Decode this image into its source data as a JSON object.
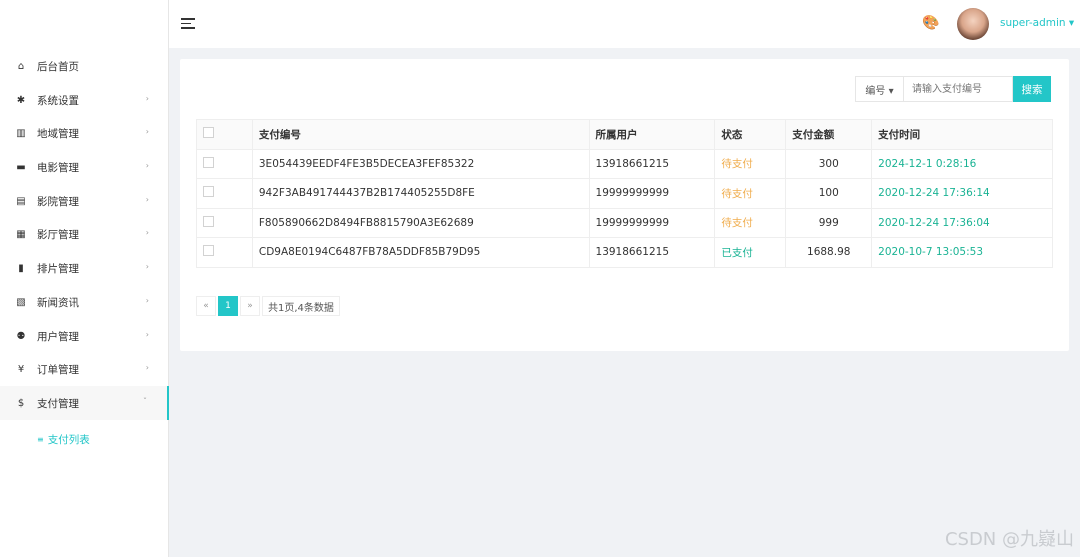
{
  "sidebar": {
    "items": [
      {
        "label": "后台首页",
        "icon": "home-icon",
        "glyph": "⌂",
        "has_arrow": false
      },
      {
        "label": "系统设置",
        "icon": "gear-icon",
        "glyph": "✱",
        "has_arrow": true
      },
      {
        "label": "地域管理",
        "icon": "map-icon",
        "glyph": "▥",
        "has_arrow": true
      },
      {
        "label": "电影管理",
        "icon": "film-icon",
        "glyph": "▬",
        "has_arrow": true
      },
      {
        "label": "影院管理",
        "icon": "cinema-icon",
        "glyph": "▤",
        "has_arrow": true
      },
      {
        "label": "影厅管理",
        "icon": "hall-icon",
        "glyph": "▦",
        "has_arrow": true
      },
      {
        "label": "排片管理",
        "icon": "schedule-icon",
        "glyph": "▮",
        "has_arrow": true
      },
      {
        "label": "新闻资讯",
        "icon": "news-icon",
        "glyph": "▧",
        "has_arrow": true
      },
      {
        "label": "用户管理",
        "icon": "users-icon",
        "glyph": "⚉",
        "has_arrow": true
      },
      {
        "label": "订单管理",
        "icon": "yen-icon",
        "glyph": "¥",
        "has_arrow": true
      },
      {
        "label": "支付管理",
        "icon": "dollar-icon",
        "glyph": "$",
        "has_arrow": true,
        "active": true
      }
    ],
    "sub_item": {
      "label": "支付列表",
      "icon": "database-icon"
    }
  },
  "header": {
    "username": "super-admin ▾"
  },
  "search": {
    "select_label": "编号 ▾",
    "placeholder": "请输入支付编号",
    "button_label": "搜索"
  },
  "table": {
    "headers": [
      "支付编号",
      "所属用户",
      "状态",
      "支付金额",
      "支付时间"
    ],
    "rows": [
      {
        "id": "3E054439EEDF4FE3B5DECEA3FEF85322",
        "user": "13918661215",
        "status": "待支付",
        "amount": "300",
        "time": "2024-12-1 0:28:16"
      },
      {
        "id": "942F3AB491744437B2B174405255D8FE",
        "user": "19999999999",
        "status": "待支付",
        "amount": "100",
        "time": "2020-12-24 17:36:14"
      },
      {
        "id": "F805890662D8494FB8815790A3E62689",
        "user": "19999999999",
        "status": "待支付",
        "amount": "999",
        "time": "2020-12-24 17:36:04"
      },
      {
        "id": "CD9A8E0194C6487FB78A5DDF85B79D95",
        "user": "13918661215",
        "status": "已支付",
        "amount": "1688.98",
        "time": "2020-10-7 13:05:53"
      }
    ]
  },
  "pager": {
    "prev": "«",
    "current": "1",
    "next": "»",
    "info": "共1页,4条数据"
  },
  "watermark": "CSDN @九嶷山",
  "colors": {
    "accent": "#23c6c8",
    "paid": "#1ab394",
    "pending": "#f0ad4e"
  }
}
